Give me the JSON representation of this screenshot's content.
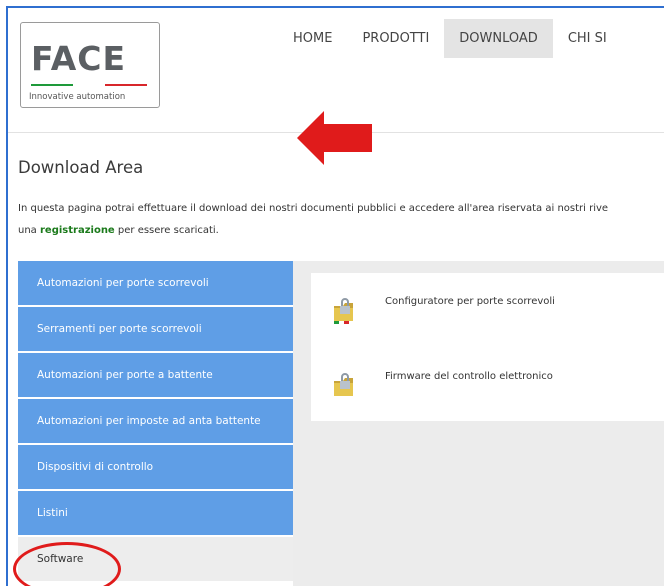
{
  "logo": {
    "brand": "FACE",
    "tagline": "Innovative automation",
    "stripe_green": "#1e9a3a",
    "stripe_red": "#d8262b"
  },
  "nav": {
    "items": [
      {
        "label": "HOME"
      },
      {
        "label": "PRODOTTI"
      },
      {
        "label": "DOWNLOAD"
      },
      {
        "label": "CHI SI"
      }
    ],
    "active_index": 2
  },
  "page": {
    "title": "Download Area",
    "intro_line1": "In questa pagina potrai effettuare il download dei nostri documenti pubblici e accedere all'area riservata ai nostri rive",
    "intro_line2_prefix": "una ",
    "intro_line2_link": "registrazione",
    "intro_line2_suffix": " per essere scaricati."
  },
  "sidebar": {
    "items": [
      {
        "label": "Automazioni per porte scorrevoli"
      },
      {
        "label": "Serramenti per porte scorrevoli"
      },
      {
        "label": "Automazioni per porte a battente"
      },
      {
        "label": "Automazioni per imposte ad anta battente"
      },
      {
        "label": "Dispositivi di controllo"
      },
      {
        "label": "Listini"
      },
      {
        "label": "Software"
      }
    ],
    "active_index": 6,
    "color": "#5f9ee6"
  },
  "downloads": {
    "items": [
      {
        "label": "Configuratore per porte scorrevoli",
        "icon": "locked-folder-italy-icon"
      },
      {
        "label": "Firmware del controllo elettronico",
        "icon": "locked-folder-icon"
      }
    ]
  },
  "annotations": {
    "arrow_color": "#e01b1b",
    "circle_color": "#e01b1b"
  }
}
